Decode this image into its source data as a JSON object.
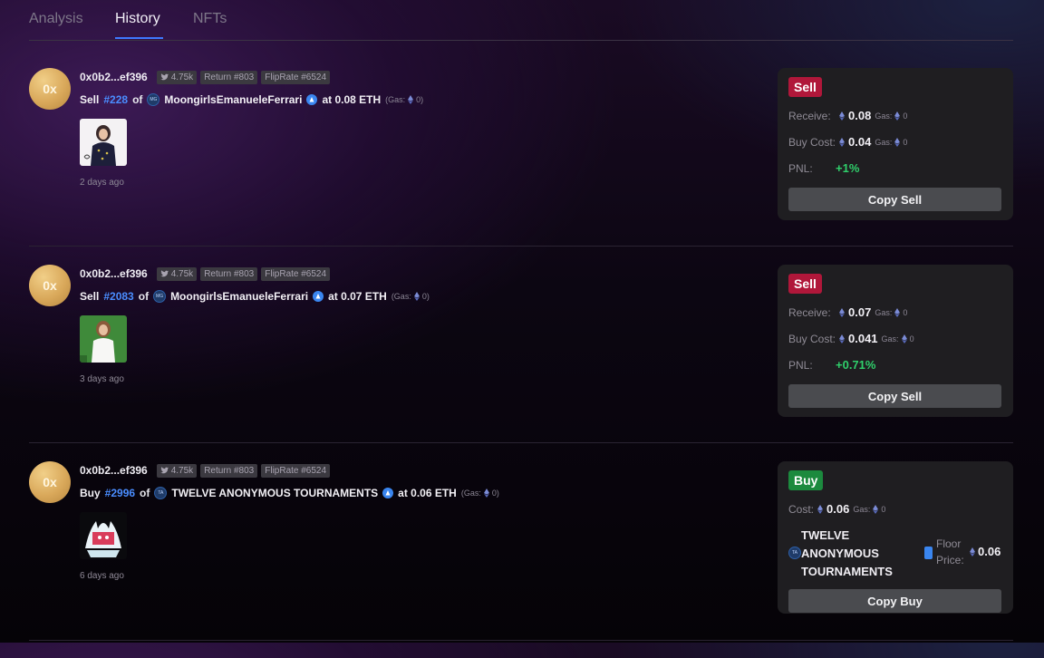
{
  "tabs": [
    {
      "label": "Analysis"
    },
    {
      "label": "History"
    },
    {
      "label": "NFTs"
    }
  ],
  "colors": {
    "accent": "#3e78ff",
    "sell": "#b0173a",
    "buy": "#1c8a3e",
    "pnl": "#2fd06b",
    "token": "#4a8dff"
  },
  "rows": [
    {
      "avatar": "0x",
      "address": "0x0b2...ef396",
      "twitter": "4.75k",
      "return_tag": "Return #803",
      "fliprate_tag": "FlipRate #6524",
      "verb": "Sell",
      "token": "#228",
      "of": "of",
      "collection": "MoongirlsEmanueleFerrari",
      "at": "at 0.08 ETH",
      "gas_label": "(Gas:",
      "gas_value": "0)",
      "time": "2 days ago",
      "card": {
        "badge": "Sell",
        "line1_label": "Receive:",
        "line1_value": "0.08",
        "line1_gas_label": "Gas:",
        "line1_gas_value": "0",
        "line2_label": "Buy Cost:",
        "line2_value": "0.04",
        "line2_gas_label": "Gas:",
        "line2_gas_value": "0",
        "pnl_label": "PNL:",
        "pnl_value": "+1%",
        "button": "Copy Sell"
      }
    },
    {
      "avatar": "0x",
      "address": "0x0b2...ef396",
      "twitter": "4.75k",
      "return_tag": "Return #803",
      "fliprate_tag": "FlipRate #6524",
      "verb": "Sell",
      "token": "#2083",
      "of": "of",
      "collection": "MoongirlsEmanueleFerrari",
      "at": "at 0.07 ETH",
      "gas_label": "(Gas:",
      "gas_value": "0)",
      "time": "3 days ago",
      "card": {
        "badge": "Sell",
        "line1_label": "Receive:",
        "line1_value": "0.07",
        "line1_gas_label": "Gas:",
        "line1_gas_value": "0",
        "line2_label": "Buy Cost:",
        "line2_value": "0.041",
        "line2_gas_label": "Gas:",
        "line2_gas_value": "0",
        "pnl_label": "PNL:",
        "pnl_value": "+0.71%",
        "button": "Copy Sell"
      }
    },
    {
      "avatar": "0x",
      "address": "0x0b2...ef396",
      "twitter": "4.75k",
      "return_tag": "Return #803",
      "fliprate_tag": "FlipRate #6524",
      "verb": "Buy",
      "token": "#2996",
      "of": "of",
      "collection": "TWELVE ANONYMOUS TOURNAMENTS",
      "at": "at 0.06 ETH",
      "gas_label": "(Gas:",
      "gas_value": "0)",
      "time": "6 days ago",
      "card": {
        "badge": "Buy",
        "cost_label": "Cost:",
        "cost_value": "0.06",
        "cost_gas_label": "Gas:",
        "cost_gas_value": "0",
        "floor_collection": "TWELVE ANONYMOUS TOURNAMENTS",
        "floor_label": "Floor Price:",
        "floor_value": "0.06",
        "button": "Copy Buy"
      }
    }
  ]
}
